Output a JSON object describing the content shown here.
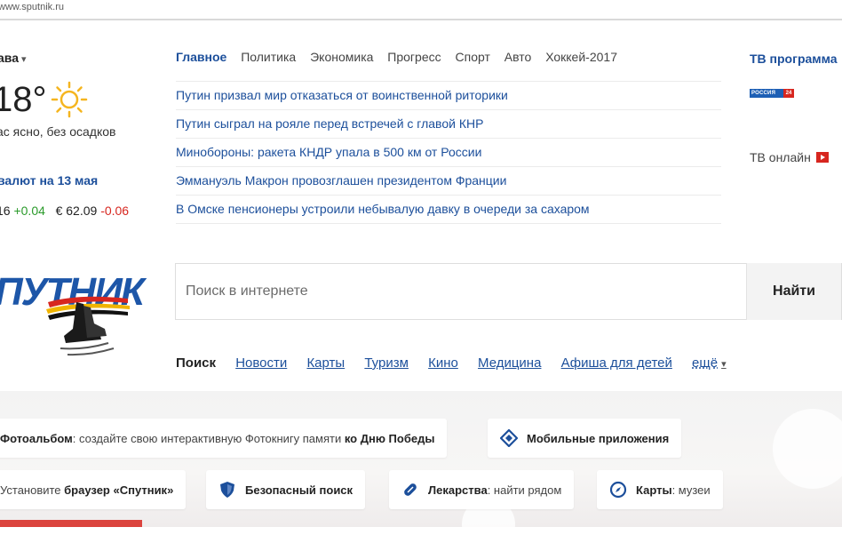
{
  "url": "www.sputnik.ru",
  "weather": {
    "city": "ава",
    "temperature": "18°",
    "description": "ас ясно, без осадков",
    "rates_title": "валют на 13 мая",
    "usd_value": "16",
    "usd_change": "+0.04",
    "eur_value": "€ 62.09",
    "eur_change": "-0.06"
  },
  "news": {
    "tabs": [
      "Главное",
      "Политика",
      "Экономика",
      "Прогресс",
      "Спорт",
      "Авто",
      "Хоккей-2017"
    ],
    "items": [
      "Путин призвал мир отказаться от воинственной риторики",
      "Путин сыграл на рояле перед встречей с главой КНР",
      "Минобороны: ракета КНДР упала в 500 км от России",
      "Эммануэль Макрон провозглашен президентом Франции",
      "В Омске пенсионеры устроили небывалую давку в очереди за сахаром"
    ]
  },
  "tv": {
    "title": "ТВ программа",
    "channel_logo": "РОССИЯ",
    "channel_number": "24",
    "online": "ТВ онлайн"
  },
  "logo": {
    "text": "ПУТНИК"
  },
  "search": {
    "placeholder": "Поиск в интернете",
    "button": "Найти",
    "tabs": [
      "Поиск",
      "Новости",
      "Карты",
      "Туризм",
      "Кино",
      "Медицина",
      "Афиша для детей",
      "ещё"
    ]
  },
  "promos": {
    "photo_album_title": "Фотоальбом",
    "photo_album_text": ": создайте свою интерактивную Фотокнигу памяти ",
    "photo_album_bold": "ко Дню Победы",
    "mobile_apps": "Мобильные приложения",
    "browser_prefix": "Установите ",
    "browser_bold": "браузер «Спутник»",
    "safe_search": "Безопасный поиск",
    "drugs_title": "Лекарства",
    "drugs_text": ": найти рядом",
    "maps_title": "Карты",
    "maps_text": ": музеи"
  },
  "colors": {
    "link": "#1c4f9b",
    "up": "#2a9a2a",
    "down": "#d7261f"
  },
  "icons": [
    "sun-icon",
    "play-icon",
    "tag-icon",
    "shield-icon",
    "pill-icon",
    "compass-icon",
    "skates-logo"
  ]
}
